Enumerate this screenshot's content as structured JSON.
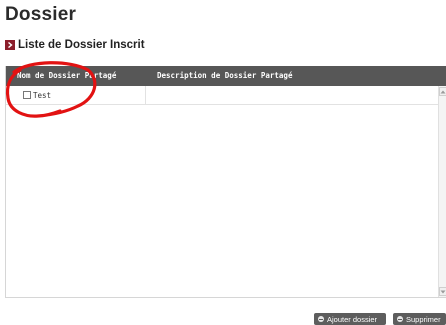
{
  "page": {
    "title": "Dossier"
  },
  "section": {
    "title": "Liste de Dossier Inscrit"
  },
  "table": {
    "columns": [
      "Nom de Dossier Partagé",
      "Description de Dossier Partagé"
    ],
    "rows": [
      {
        "name": "Test",
        "description": "",
        "checked": false
      }
    ]
  },
  "actions": {
    "add_label": "Ajouter dossier",
    "delete_label": "Supprimer"
  },
  "icons": {
    "section_bullet": "chevron-right-icon",
    "add": "plus-circle-icon",
    "delete": "minus-circle-icon",
    "scroll_up": "arrow-up-icon",
    "scroll_down": "arrow-down-icon"
  },
  "colors": {
    "header_bg": "#575757",
    "accent": "#8b1d2a",
    "annotation": "#e21212",
    "button_bg": "#5d5d5d"
  }
}
